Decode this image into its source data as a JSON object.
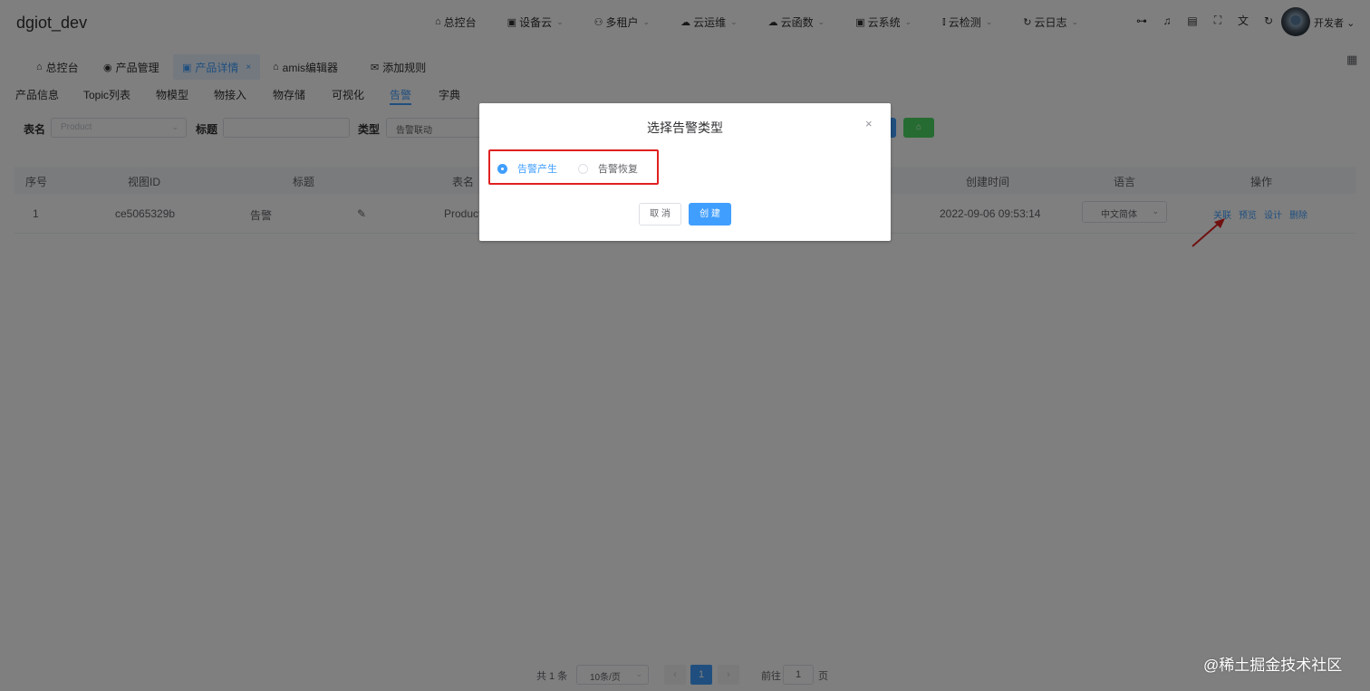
{
  "app": {
    "title": "dgiot_dev"
  },
  "topnav": [
    {
      "label": "总控台",
      "icon": "home-icon",
      "glyph": "⌂",
      "chevron": false
    },
    {
      "label": "设备云",
      "icon": "device-icon",
      "glyph": "▣",
      "chevron": true
    },
    {
      "label": "多租户",
      "icon": "users-icon",
      "glyph": "⚇",
      "chevron": true
    },
    {
      "label": "云运维",
      "icon": "cloud-icon",
      "glyph": "☁",
      "chevron": true
    },
    {
      "label": "云函数",
      "icon": "cloud-function-icon",
      "glyph": "☁",
      "chevron": true
    },
    {
      "label": "云系统",
      "icon": "system-icon",
      "glyph": "▣",
      "chevron": true
    },
    {
      "label": "云检测",
      "icon": "test-tube-icon",
      "glyph": "⫾",
      "chevron": true
    },
    {
      "label": "云日志",
      "icon": "log-icon",
      "glyph": "↻",
      "chevron": true
    }
  ],
  "tools": [
    {
      "name": "tree-icon",
      "glyph": "⊶"
    },
    {
      "name": "bell-icon",
      "glyph": "♫"
    },
    {
      "name": "document-icon",
      "glyph": "▤"
    },
    {
      "name": "fullscreen-icon",
      "glyph": "⛶"
    },
    {
      "name": "language-icon",
      "glyph": "文"
    },
    {
      "name": "refresh-icon",
      "glyph": "↻"
    }
  ],
  "user": {
    "name": "开发者",
    "chevron": "⌄"
  },
  "tags": {
    "dashboard": {
      "label": "总控台",
      "glyph": "⌂"
    },
    "product_mgmt": {
      "label": "产品管理",
      "glyph": "◉"
    },
    "product_detail": {
      "label": "产品详情",
      "glyph": "▣",
      "close": "×"
    },
    "amis": {
      "label": "amis编辑器",
      "glyph": "⌂"
    },
    "add_rule": {
      "label": "添加规则",
      "glyph": "✉"
    }
  },
  "subtabs": {
    "info": "产品信息",
    "topic": "Topic列表",
    "model": "物模型",
    "access": "物接入",
    "storage": "物存储",
    "visual": "可视化",
    "alarm": "告警",
    "dict": "字典"
  },
  "filter": {
    "table_label": "表名",
    "table_placeholder": "Product",
    "title_label": "标题",
    "type_label": "类型",
    "type_value": "告警联动",
    "green_btn": "⌂"
  },
  "table": {
    "headers": {
      "index": "序号",
      "view_id": "视图ID",
      "title": "标题",
      "table_name": "表名",
      "created": "创建时间",
      "language": "语言",
      "actions": "操作"
    },
    "row": {
      "index": "1",
      "view_id": "ce5065329b",
      "title": "告警",
      "table_name": "Product",
      "created": "2022-09-06 09:53:14",
      "language": "中文简体",
      "actions": {
        "link": "关联",
        "preview": "预览",
        "design": "设计",
        "delete": "删除"
      }
    }
  },
  "pagination": {
    "total": "共 1 条",
    "page_size": "10条/页",
    "prev": "‹",
    "current": "1",
    "next": "›",
    "goto_label": "前往",
    "goto_value": "1",
    "goto_suffix": "页"
  },
  "watermark": "@稀土掘金技术社区",
  "dialog": {
    "title": "选择告警类型",
    "close": "×",
    "options": [
      "告警产生",
      "告警恢复"
    ],
    "selected": "告警产生",
    "cancel_label": "取 消",
    "create_label": "创 建"
  },
  "colors": {
    "primary": "#409eff",
    "success": "#4cd964",
    "highlight_box": "#e02020"
  }
}
